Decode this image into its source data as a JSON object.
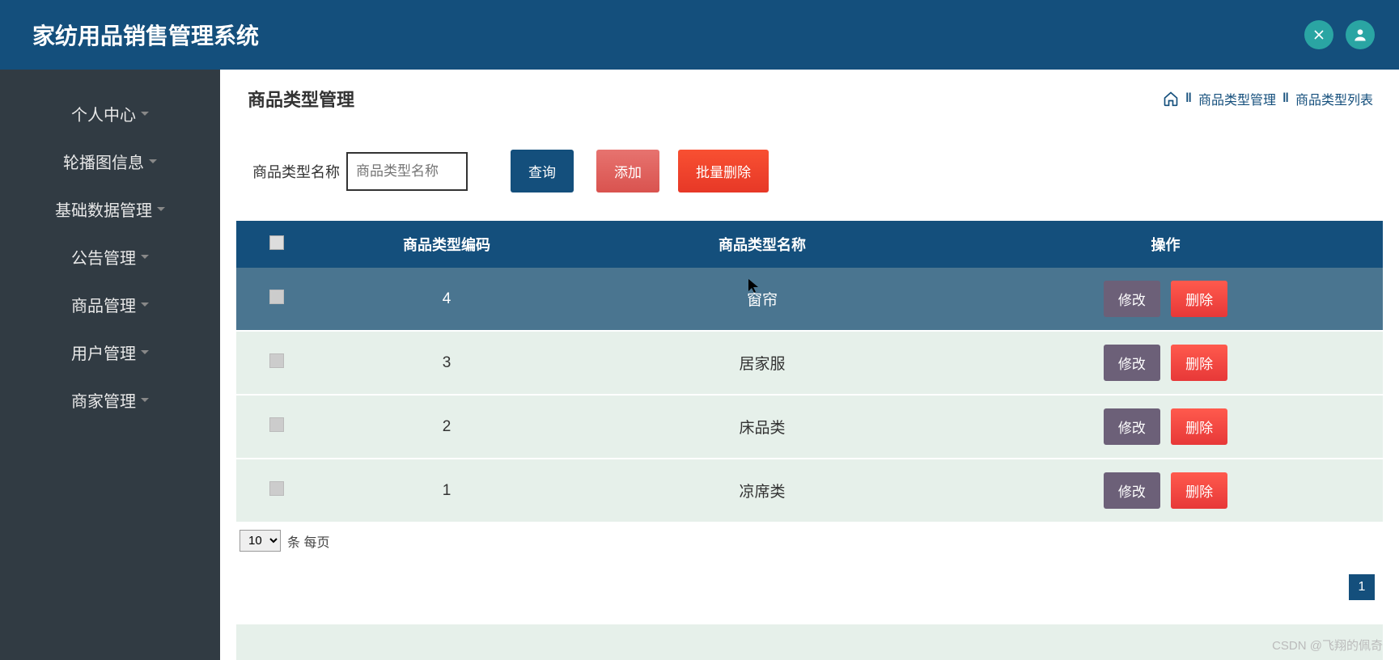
{
  "header": {
    "title": "家纺用品销售管理系统"
  },
  "sidebar": {
    "items": [
      {
        "label": "个人中心"
      },
      {
        "label": "轮播图信息"
      },
      {
        "label": "基础数据管理"
      },
      {
        "label": "公告管理"
      },
      {
        "label": "商品管理"
      },
      {
        "label": "用户管理"
      },
      {
        "label": "商家管理"
      }
    ]
  },
  "page": {
    "title": "商品类型管理"
  },
  "breadcrumb": {
    "item1": "商品类型管理",
    "item2": "商品类型列表"
  },
  "filter": {
    "label": "商品类型名称",
    "placeholder": "商品类型名称",
    "query_btn": "查询",
    "add_btn": "添加",
    "batch_del_btn": "批量删除"
  },
  "table": {
    "headers": {
      "code": "商品类型编码",
      "name": "商品类型名称",
      "ops": "操作"
    },
    "rows": [
      {
        "code": "4",
        "name": "窗帘",
        "hovered": true
      },
      {
        "code": "3",
        "name": "居家服",
        "hovered": false
      },
      {
        "code": "2",
        "name": "床品类",
        "hovered": false
      },
      {
        "code": "1",
        "name": "凉席类",
        "hovered": false
      }
    ],
    "edit_btn": "修改",
    "del_btn": "删除"
  },
  "pager": {
    "page_size": "10",
    "label": "条 每页",
    "current_page": "1"
  },
  "watermark": "CSDN @飞翔的佩奇"
}
